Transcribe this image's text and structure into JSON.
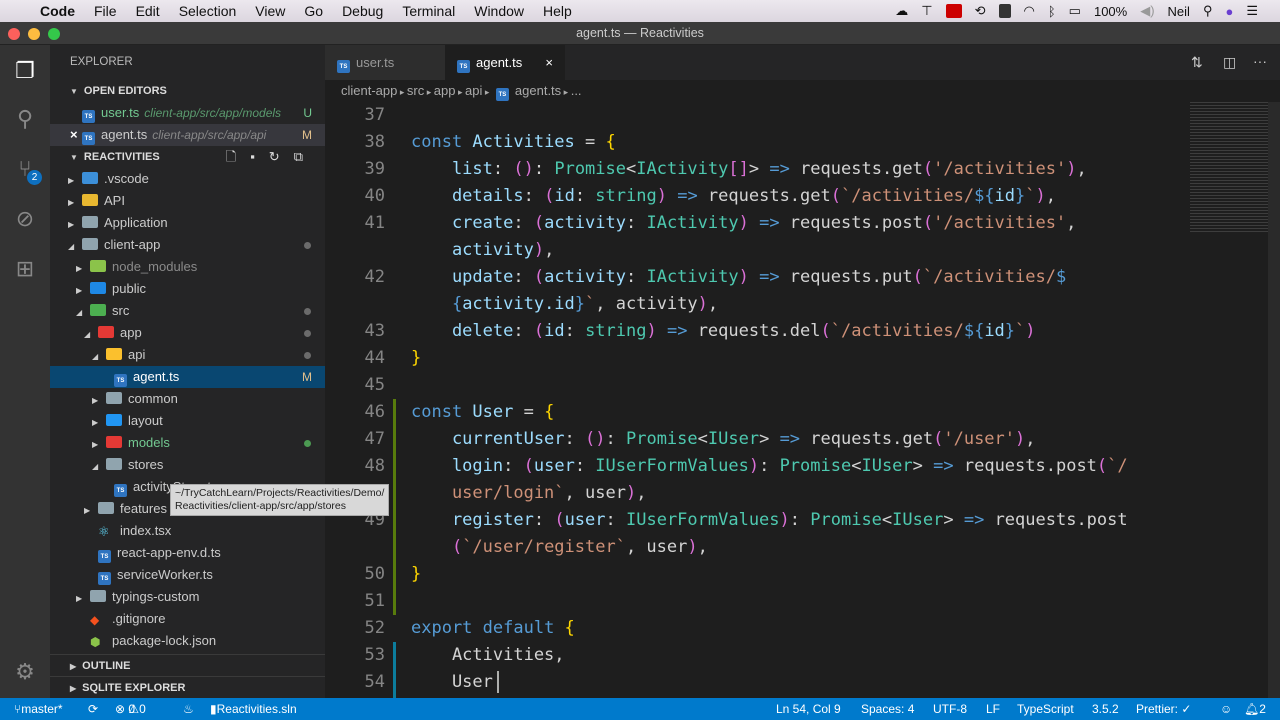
{
  "menubar": {
    "app": "Code",
    "items": [
      "File",
      "Edit",
      "Selection",
      "View",
      "Go",
      "Debug",
      "Terminal",
      "Window",
      "Help"
    ],
    "battery": "100%",
    "user": "Neil"
  },
  "window": {
    "title": "agent.ts — Reactivities"
  },
  "activity": {
    "scm_badge": "2"
  },
  "sidebar": {
    "title": "EXPLORER",
    "open_editors_label": "OPEN EDITORS",
    "open_editors": [
      {
        "name": "user.ts",
        "path": "client-app/src/app/models",
        "badge": "U",
        "color": "#73c991"
      },
      {
        "name": "agent.ts",
        "path": "client-app/src/app/api",
        "badge": "M",
        "color": "#e2c08d"
      }
    ],
    "project_label": "REACTIVITIES",
    "tree": [
      {
        "label": ".vscode",
        "depth": 0,
        "arrow": "closed",
        "icon": "#3c8fd8"
      },
      {
        "label": "API",
        "depth": 0,
        "arrow": "closed",
        "icon": "#e8b730"
      },
      {
        "label": "Application",
        "depth": 0,
        "arrow": "closed",
        "icon": "#90a4ae"
      },
      {
        "label": "client-app",
        "depth": 0,
        "arrow": "open",
        "icon": "#90a4ae",
        "dot": true
      },
      {
        "label": "node_modules",
        "depth": 1,
        "arrow": "closed",
        "icon": "#8bc34a",
        "dim": true
      },
      {
        "label": "public",
        "depth": 1,
        "arrow": "closed",
        "icon": "#1e88e5"
      },
      {
        "label": "src",
        "depth": 1,
        "arrow": "open",
        "icon": "#4caf50",
        "dot": true
      },
      {
        "label": "app",
        "depth": 2,
        "arrow": "open",
        "icon": "#e53935",
        "dot": true
      },
      {
        "label": "api",
        "depth": 3,
        "arrow": "open",
        "icon": "#fbc02d",
        "dot": true
      },
      {
        "label": "agent.ts",
        "depth": 4,
        "file": "ts",
        "selected": true,
        "badge": "M"
      },
      {
        "label": "common",
        "depth": 3,
        "arrow": "closed",
        "icon": "#90a4ae"
      },
      {
        "label": "layout",
        "depth": 3,
        "arrow": "closed",
        "icon": "#2196f3"
      },
      {
        "label": "models",
        "depth": 3,
        "arrow": "closed",
        "icon": "#e53935",
        "color": "#73c991",
        "greendot": true
      },
      {
        "label": "stores",
        "depth": 3,
        "arrow": "open",
        "icon": "#90a4ae"
      },
      {
        "label": "activityStore.ts",
        "depth": 4,
        "file": "ts"
      },
      {
        "label": "features",
        "depth": 2,
        "arrow": "closed",
        "icon": "#90a4ae"
      },
      {
        "label": "index.tsx",
        "depth": 2,
        "file": "react"
      },
      {
        "label": "react-app-env.d.ts",
        "depth": 2,
        "file": "ts"
      },
      {
        "label": "serviceWorker.ts",
        "depth": 2,
        "file": "ts"
      },
      {
        "label": "typings-custom",
        "depth": 1,
        "arrow": "closed",
        "icon": "#90a4ae"
      },
      {
        "label": ".gitignore",
        "depth": 1,
        "file": "git"
      },
      {
        "label": "package-lock.json",
        "depth": 1,
        "file": "npm"
      }
    ],
    "tooltip": [
      "~/TryCatchLearn/Projects/Reactivities/Demo/",
      "Reactivities/client-app/src/app/stores"
    ],
    "outline_label": "OUTLINE",
    "sqlite_label": "SQLITE EXPLORER"
  },
  "tabs": [
    {
      "label": "user.ts"
    },
    {
      "label": "agent.ts",
      "close": "×"
    }
  ],
  "breadcrumb": [
    "client-app",
    "src",
    "app",
    "api",
    "agent.ts",
    "..."
  ],
  "code": [
    {
      "n": "37",
      "t": []
    },
    {
      "n": "38",
      "t": [
        [
          "const ",
          "kw"
        ],
        [
          "Activities",
          "pr"
        ],
        [
          " = ",
          "pl"
        ],
        [
          "{",
          "br"
        ]
      ]
    },
    {
      "n": "39",
      "t": [
        [
          "    list",
          "pr"
        ],
        [
          ": ",
          "pl"
        ],
        [
          "()",
          "p1"
        ],
        [
          ": ",
          "pl"
        ],
        [
          "Promise",
          "ty"
        ],
        [
          "<",
          "pl"
        ],
        [
          "IActivity",
          "ty"
        ],
        [
          "[]",
          "p1"
        ],
        [
          "> ",
          "pl"
        ],
        [
          "=>",
          "kw"
        ],
        [
          " requests.get",
          "pl"
        ],
        [
          "(",
          "p1"
        ],
        [
          "'/activities'",
          "st"
        ],
        [
          ")",
          "p1"
        ],
        [
          ",",
          "pl"
        ]
      ]
    },
    {
      "n": "40",
      "t": [
        [
          "    details",
          "pr"
        ],
        [
          ": ",
          "pl"
        ],
        [
          "(",
          "p1"
        ],
        [
          "id",
          "pr"
        ],
        [
          ": ",
          "pl"
        ],
        [
          "string",
          "ty"
        ],
        [
          ")",
          "p1"
        ],
        [
          " => ",
          "kw"
        ],
        [
          "requests.get",
          "pl"
        ],
        [
          "(",
          "p1"
        ],
        [
          "`/activities/",
          "st"
        ],
        [
          "${",
          "kw"
        ],
        [
          "id",
          "pr"
        ],
        [
          "}",
          "kw"
        ],
        [
          "`",
          "st"
        ],
        [
          ")",
          "p1"
        ],
        [
          ",",
          "pl"
        ]
      ]
    },
    {
      "n": "41",
      "t": [
        [
          "    create",
          "pr"
        ],
        [
          ": ",
          "pl"
        ],
        [
          "(",
          "p1"
        ],
        [
          "activity",
          "pr"
        ],
        [
          ": ",
          "pl"
        ],
        [
          "IActivity",
          "ty"
        ],
        [
          ")",
          "p1"
        ],
        [
          " => ",
          "kw"
        ],
        [
          "requests.post",
          "pl"
        ],
        [
          "(",
          "p1"
        ],
        [
          "'/activities'",
          "st"
        ],
        [
          ",",
          "pl"
        ]
      ]
    },
    {
      "n": "",
      "t": [
        [
          "    activity",
          "pr"
        ],
        [
          ")",
          "p1"
        ],
        [
          ",",
          "pl"
        ]
      ]
    },
    {
      "n": "42",
      "t": [
        [
          "    update",
          "pr"
        ],
        [
          ": ",
          "pl"
        ],
        [
          "(",
          "p1"
        ],
        [
          "activity",
          "pr"
        ],
        [
          ": ",
          "pl"
        ],
        [
          "IActivity",
          "ty"
        ],
        [
          ")",
          "p1"
        ],
        [
          " => ",
          "kw"
        ],
        [
          "requests.put",
          "pl"
        ],
        [
          "(",
          "p1"
        ],
        [
          "`/activities/",
          "st"
        ],
        [
          "$",
          "kw"
        ]
      ]
    },
    {
      "n": "",
      "t": [
        [
          "    {",
          "kw"
        ],
        [
          "activity.id",
          "pr"
        ],
        [
          "}",
          "kw"
        ],
        [
          "`",
          "st"
        ],
        [
          ", activity",
          "pl"
        ],
        [
          ")",
          "p1"
        ],
        [
          ",",
          "pl"
        ]
      ]
    },
    {
      "n": "43",
      "t": [
        [
          "    delete",
          "pr"
        ],
        [
          ": ",
          "pl"
        ],
        [
          "(",
          "p1"
        ],
        [
          "id",
          "pr"
        ],
        [
          ": ",
          "pl"
        ],
        [
          "string",
          "ty"
        ],
        [
          ")",
          "p1"
        ],
        [
          " => ",
          "kw"
        ],
        [
          "requests.del",
          "pl"
        ],
        [
          "(",
          "p1"
        ],
        [
          "`/activities/",
          "st"
        ],
        [
          "${",
          "kw"
        ],
        [
          "id",
          "pr"
        ],
        [
          "}",
          "kw"
        ],
        [
          "`",
          "st"
        ],
        [
          ")",
          "p1"
        ]
      ]
    },
    {
      "n": "44",
      "t": [
        [
          "}",
          "br"
        ]
      ]
    },
    {
      "n": "45",
      "t": []
    },
    {
      "n": "46",
      "t": [
        [
          "const ",
          "kw"
        ],
        [
          "User",
          "pr"
        ],
        [
          " = ",
          "pl"
        ],
        [
          "{",
          "br"
        ]
      ]
    },
    {
      "n": "47",
      "t": [
        [
          "    currentUser",
          "pr"
        ],
        [
          ": ",
          "pl"
        ],
        [
          "()",
          "p1"
        ],
        [
          ": ",
          "pl"
        ],
        [
          "Promise",
          "ty"
        ],
        [
          "<",
          "pl"
        ],
        [
          "IUser",
          "ty"
        ],
        [
          "> ",
          "pl"
        ],
        [
          "=>",
          "kw"
        ],
        [
          " requests.get",
          "pl"
        ],
        [
          "(",
          "p1"
        ],
        [
          "'/user'",
          "st"
        ],
        [
          ")",
          "p1"
        ],
        [
          ",",
          "pl"
        ]
      ]
    },
    {
      "n": "48",
      "t": [
        [
          "    login",
          "pr"
        ],
        [
          ": ",
          "pl"
        ],
        [
          "(",
          "p1"
        ],
        [
          "user",
          "pr"
        ],
        [
          ": ",
          "pl"
        ],
        [
          "IUserFormValues",
          "ty"
        ],
        [
          ")",
          "p1"
        ],
        [
          ": ",
          "pl"
        ],
        [
          "Promise",
          "ty"
        ],
        [
          "<",
          "pl"
        ],
        [
          "IUser",
          "ty"
        ],
        [
          "> ",
          "pl"
        ],
        [
          "=>",
          "kw"
        ],
        [
          " requests.post",
          "pl"
        ],
        [
          "(",
          "p1"
        ],
        [
          "`/",
          "st"
        ]
      ]
    },
    {
      "n": "",
      "t": [
        [
          "    user/login`",
          "st"
        ],
        [
          ", user",
          "pl"
        ],
        [
          ")",
          "p1"
        ],
        [
          ",",
          "pl"
        ]
      ]
    },
    {
      "n": "49",
      "t": [
        [
          "    register",
          "pr"
        ],
        [
          ": ",
          "pl"
        ],
        [
          "(",
          "p1"
        ],
        [
          "user",
          "pr"
        ],
        [
          ": ",
          "pl"
        ],
        [
          "IUserFormValues",
          "ty"
        ],
        [
          ")",
          "p1"
        ],
        [
          ": ",
          "pl"
        ],
        [
          "Promise",
          "ty"
        ],
        [
          "<",
          "pl"
        ],
        [
          "IUser",
          "ty"
        ],
        [
          "> ",
          "pl"
        ],
        [
          "=>",
          "kw"
        ],
        [
          " requests.post",
          "pl"
        ]
      ]
    },
    {
      "n": "",
      "t": [
        [
          "    (",
          "p1"
        ],
        [
          "`/user/register`",
          "st"
        ],
        [
          ", user",
          "pl"
        ],
        [
          ")",
          "p1"
        ],
        [
          ",",
          "pl"
        ]
      ]
    },
    {
      "n": "50",
      "t": [
        [
          "}",
          "br"
        ]
      ]
    },
    {
      "n": "51",
      "t": []
    },
    {
      "n": "52",
      "t": [
        [
          "export ",
          "kw"
        ],
        [
          "default ",
          "kw"
        ],
        [
          "{",
          "br"
        ]
      ]
    },
    {
      "n": "53",
      "t": [
        [
          "    Activities",
          "pl"
        ],
        [
          ",",
          "pl"
        ]
      ]
    },
    {
      "n": "54",
      "t": [
        [
          "    User",
          "pl"
        ]
      ]
    }
  ],
  "status": {
    "branch": "master*",
    "errors": "0",
    "warnings": "0",
    "solution": "Reactivities.sln",
    "position": "Ln 54, Col 9",
    "spaces": "Spaces: 4",
    "encoding": "UTF-8",
    "eol": "LF",
    "language": "TypeScript",
    "version": "3.5.2",
    "prettier": "Prettier: ✓",
    "bell": "2"
  }
}
